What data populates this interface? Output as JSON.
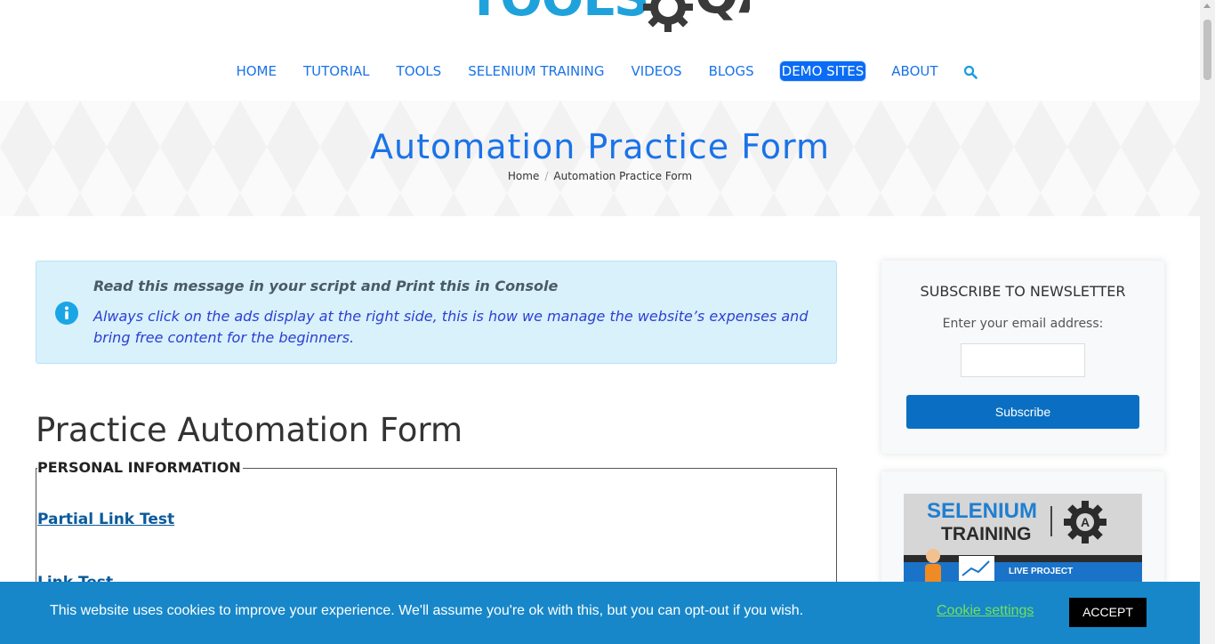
{
  "header": {
    "logo_text": "TOOLS",
    "logo_qa": "QA",
    "nav": [
      {
        "label": "HOME"
      },
      {
        "label": "TUTORIAL"
      },
      {
        "label": "TOOLS"
      },
      {
        "label": "SELENIUM TRAINING"
      },
      {
        "label": "VIDEOS"
      },
      {
        "label": "BLOGS"
      },
      {
        "label": "DEMO SITES",
        "active": true
      },
      {
        "label": "ABOUT"
      }
    ],
    "search_icon": "search-icon"
  },
  "banner": {
    "title": "Automation Practice Form",
    "breadcrumb": {
      "home": "Home",
      "separator": "/",
      "current": "Automation Practice Form"
    }
  },
  "info_box": {
    "icon": "info-icon",
    "title": "Read this message in your script and Print this in Console",
    "body": "Always click on the ads display at the right side, this is how we manage the website’s expenses and bring free content for the beginners."
  },
  "form": {
    "heading": "Practice Automation Form",
    "legend": "PERSONAL INFORMATION",
    "links": [
      "Partial Link Test",
      "Link Test"
    ]
  },
  "sidebar": {
    "newsletter": {
      "title": "SUBSCRIBE TO NEWSLETTER",
      "label": "Enter your email address:",
      "email_value": "",
      "button": "Subscribe"
    },
    "ad": {
      "line1": "SELENIUM",
      "line2": "TRAINING",
      "badge": "LIVE PROJECT"
    }
  },
  "cookie_bar": {
    "message": "This website uses cookies to improve your experience. We'll assume you're ok with this, but you can opt-out if you wish.",
    "settings": "Cookie settings",
    "accept": "ACCEPT"
  },
  "colors": {
    "brand_blue": "#1a73e8",
    "info_bg": "#d9f1fb",
    "cookie_bg": "#1787c9",
    "cookie_link": "#73e05a",
    "button_blue": "#0a6fc2"
  }
}
